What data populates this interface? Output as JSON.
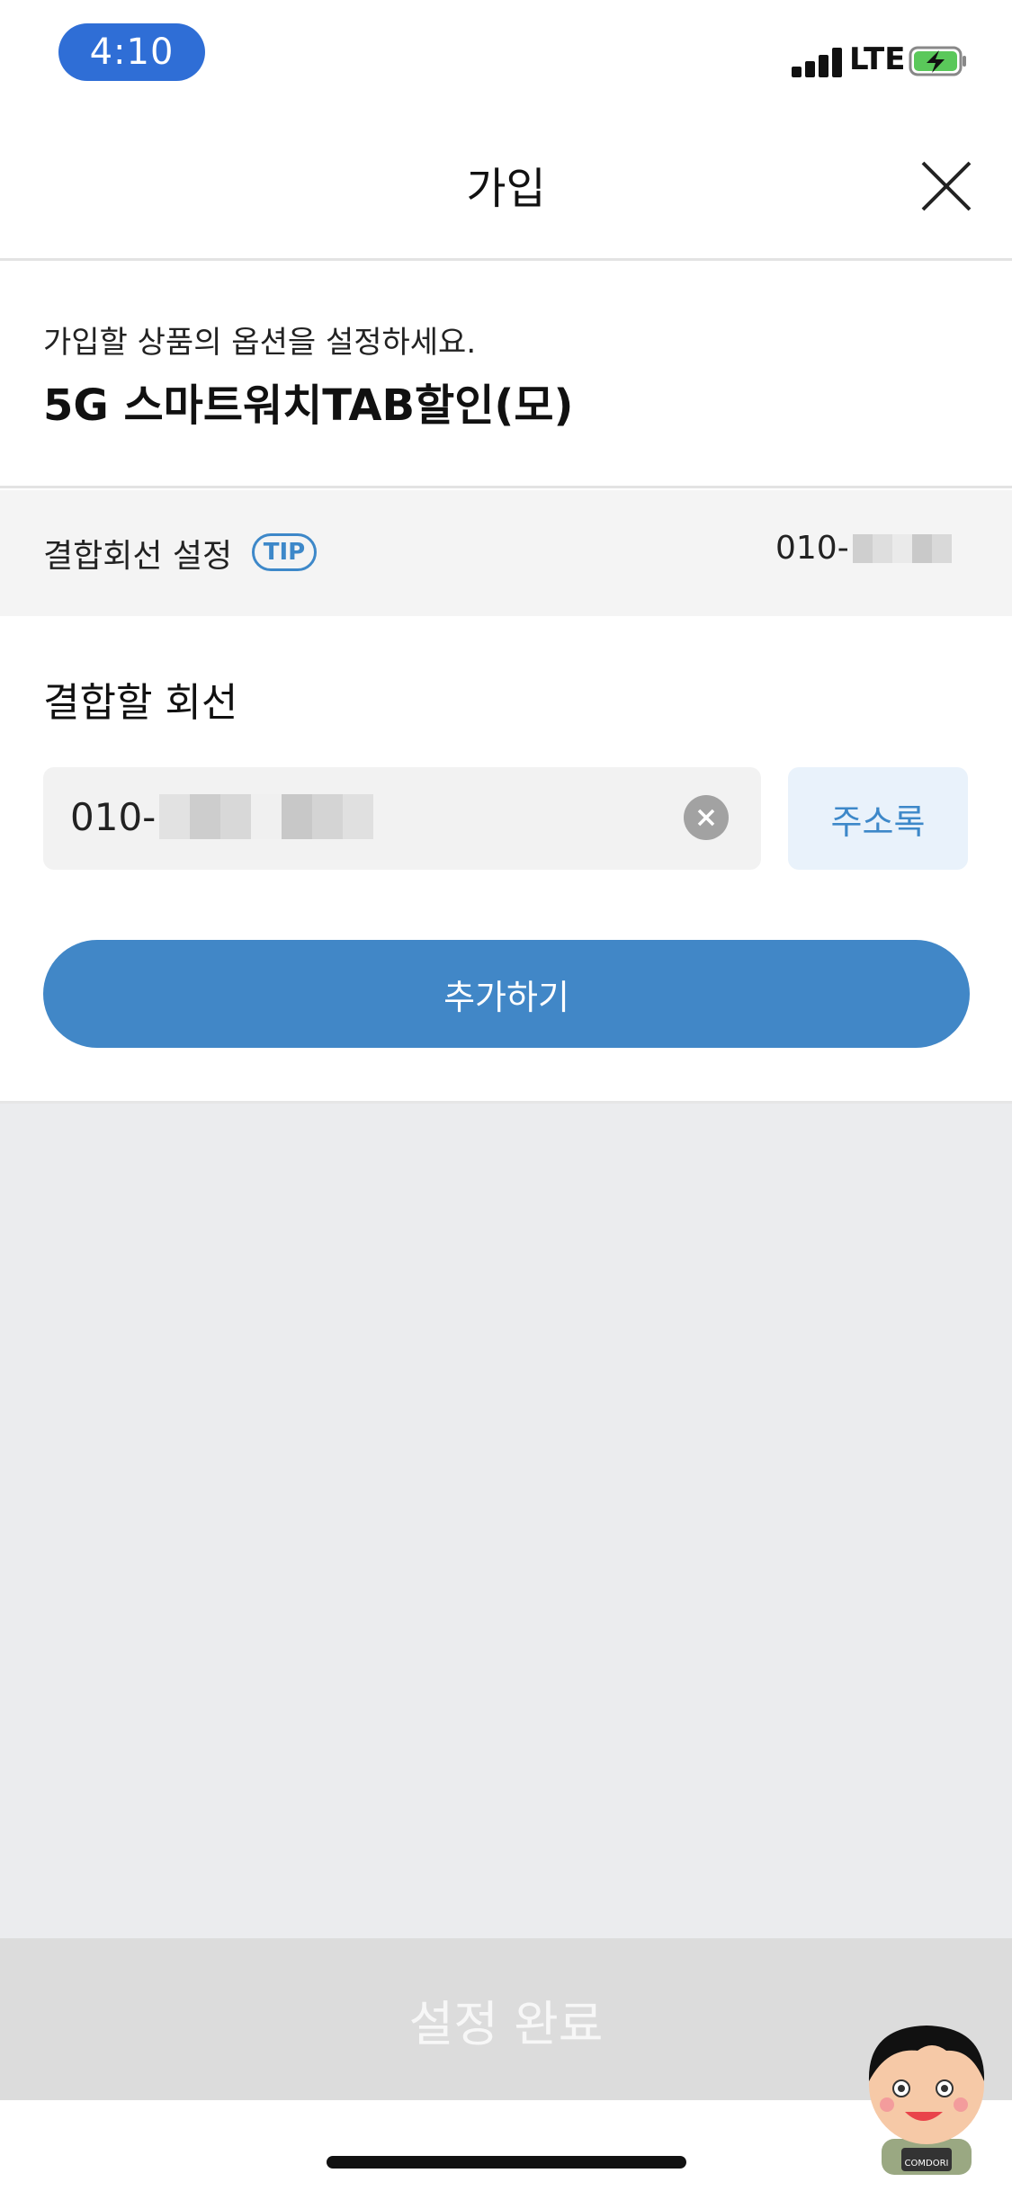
{
  "status_bar": {
    "time": "4:10",
    "network": "LTE",
    "icons": [
      "signal-icon",
      "battery-charging-icon"
    ]
  },
  "header": {
    "title": "가입",
    "close_icon": "close-icon"
  },
  "intro": {
    "subtitle": "가입할 상품의 옵션을 설정하세요.",
    "product_name": "5G 스마트워치TAB할인(모)"
  },
  "combo_setting": {
    "label": "결합회선 설정",
    "tip": "TIP",
    "phone_prefix": "010-"
  },
  "line_section": {
    "title": "결합할 회선",
    "input_value_prefix": "010-",
    "clear_icon": "clear-icon",
    "address_book_button": "주소록",
    "add_button": "추가하기"
  },
  "footer": {
    "complete_button": "설정 완료"
  },
  "colors": {
    "accent": "#4187c7",
    "time_pill": "#2f6ed6",
    "tip_blue": "#3d88c9",
    "disabled_bar": "#dcdcdc",
    "empty_bg": "#ebecee"
  }
}
